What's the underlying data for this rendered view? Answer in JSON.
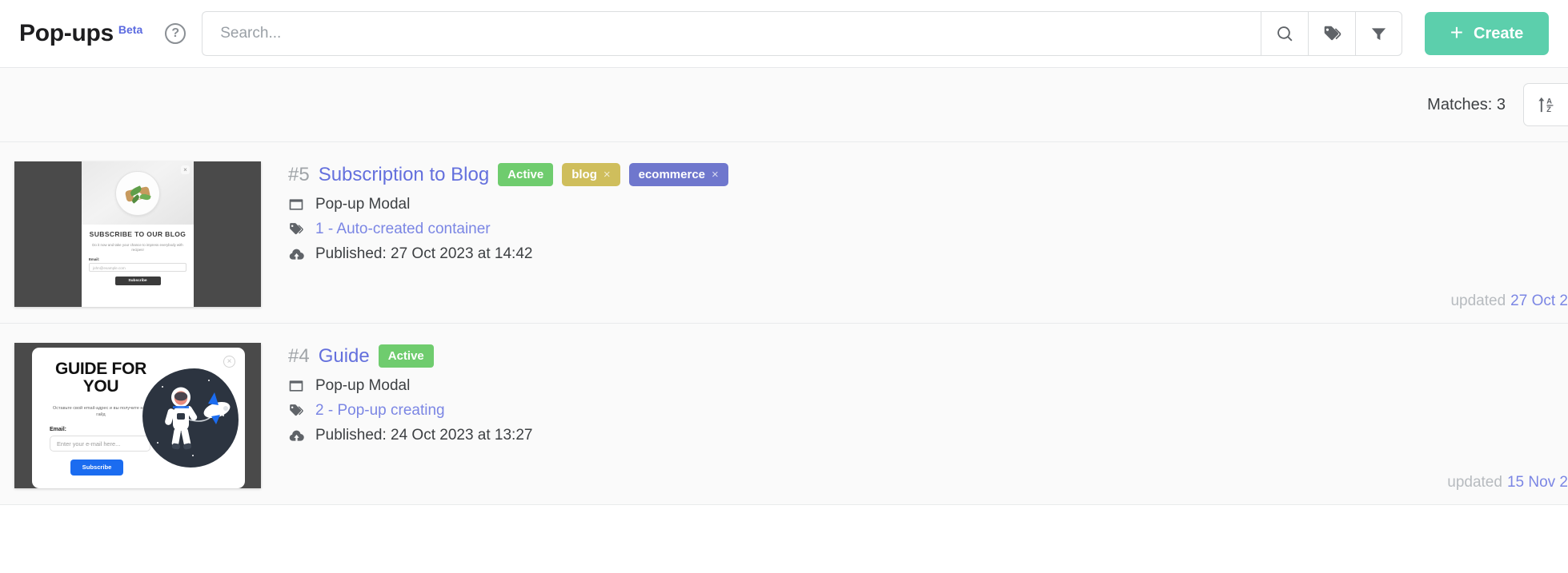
{
  "header": {
    "title": "Pop-ups",
    "beta_label": "Beta",
    "help_icon": "question-circle-icon",
    "search_placeholder": "Search...",
    "search_value": "",
    "search_icon": "search-icon",
    "tags_icon": "tags-icon",
    "filter_icon": "filter-icon",
    "create_label": "Create",
    "create_plus": "+",
    "create_color": "#5ccfac"
  },
  "toolbar": {
    "matches_label": "Matches: 3",
    "sort_icon": "sort-alpha-asc-icon",
    "sort_arrow": "↑",
    "sort_a": "A",
    "sort_z": "Z"
  },
  "colors": {
    "accent": "#6470dd",
    "active_badge": "#6fcc6e",
    "tag_blog": "#cfbe5c",
    "tag_ecommerce": "#6f77cd",
    "create": "#5ccfac"
  },
  "items": [
    {
      "number": "#5",
      "title": "Subscription to Blog",
      "status": "Active",
      "tags": [
        {
          "label": "blog",
          "color": "#cfbe5c",
          "remove": "×"
        },
        {
          "label": "ecommerce",
          "color": "#6f77cd",
          "remove": "×"
        }
      ],
      "type_icon": "modal-window-icon",
      "type": "Pop-up Modal",
      "container_icon": "tag-icon",
      "container": "1 - Auto-created container",
      "published_icon": "cloud-upload-icon",
      "published": "Published: 27 Oct 2023 at 14:42",
      "updated_label": "updated",
      "updated_date": "27 Oct 2",
      "thumbnail": {
        "kind": "subscribe-blog-modal",
        "title": "SUBSCRIBE TO OUR BLOG",
        "subtitle": "Do it now and take your chance to impress everybody with recipes!",
        "field_label": "Email:",
        "field_value": "john@example.com",
        "button_label": "Subscribe",
        "close_icon": "close-icon"
      }
    },
    {
      "number": "#4",
      "title": "Guide",
      "status": "Active",
      "tags": [],
      "type_icon": "modal-window-icon",
      "type": "Pop-up Modal",
      "container_icon": "tag-icon",
      "container": "2 - Pop-up creating",
      "published_icon": "cloud-upload-icon",
      "published": "Published: 24 Oct 2023 at 13:27",
      "updated_label": "updated",
      "updated_date": "15 Nov 2",
      "thumbnail": {
        "kind": "guide-astronaut-modal",
        "title": "GUIDE FOR YOU",
        "subtitle": "Оставьте свой email-адрес и вы получите наш гайд",
        "field_label": "Email:",
        "field_value": "Enter your e-mail here...",
        "button_label": "Subscribe",
        "close_icon": "close-icon"
      }
    }
  ]
}
